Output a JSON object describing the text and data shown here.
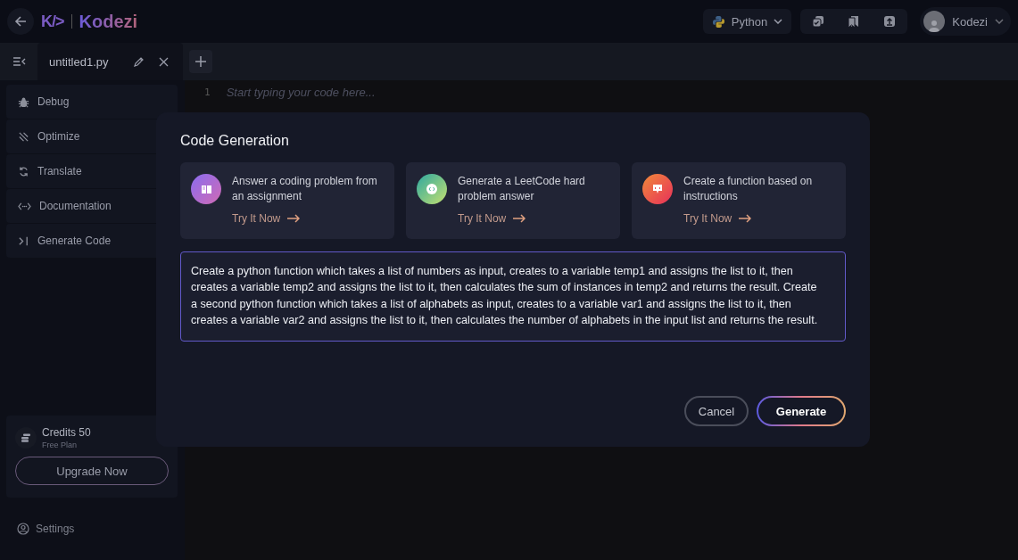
{
  "header": {
    "logo_mark": "K/>",
    "logo_text": "Kodezi",
    "language": "Python",
    "user": "Kodezi"
  },
  "tabs": [
    {
      "label": "untitled1.py",
      "selected": true
    }
  ],
  "sidebar": {
    "items": [
      {
        "label": "Debug"
      },
      {
        "label": "Optimize"
      },
      {
        "label": "Translate"
      },
      {
        "label": "Documentation"
      },
      {
        "label": "Generate Code"
      }
    ],
    "credits": {
      "title": "Credits 50",
      "plan": "Free Plan",
      "button": "Upgrade Now"
    },
    "settings": "Settings"
  },
  "editor": {
    "line_number": "1",
    "placeholder": "Start typing your code here..."
  },
  "dialog": {
    "title": "Code Generation",
    "cards": [
      {
        "text": "Answer a coding problem from an assignment",
        "link": "Try It Now"
      },
      {
        "text": "Generate a LeetCode hard problem answer",
        "link": "Try It Now"
      },
      {
        "text": "Create a function based on instructions",
        "link": "Try It Now"
      }
    ],
    "prompt": "Create a python function which takes a list of numbers as input, creates to a variable temp1 and assigns the list to it, then creates a variable temp2 and assigns the list to it, then calculates the sum of instances in temp2 and returns the result. Create a second python function which takes a list of alphabets as input, creates to a variable var1 and assigns the list to it, then creates a variable var2 and assigns the list to it, then calculates the number of alphabets in the input list and returns the result.",
    "buttons": [
      "Cancel",
      "Generate"
    ]
  }
}
